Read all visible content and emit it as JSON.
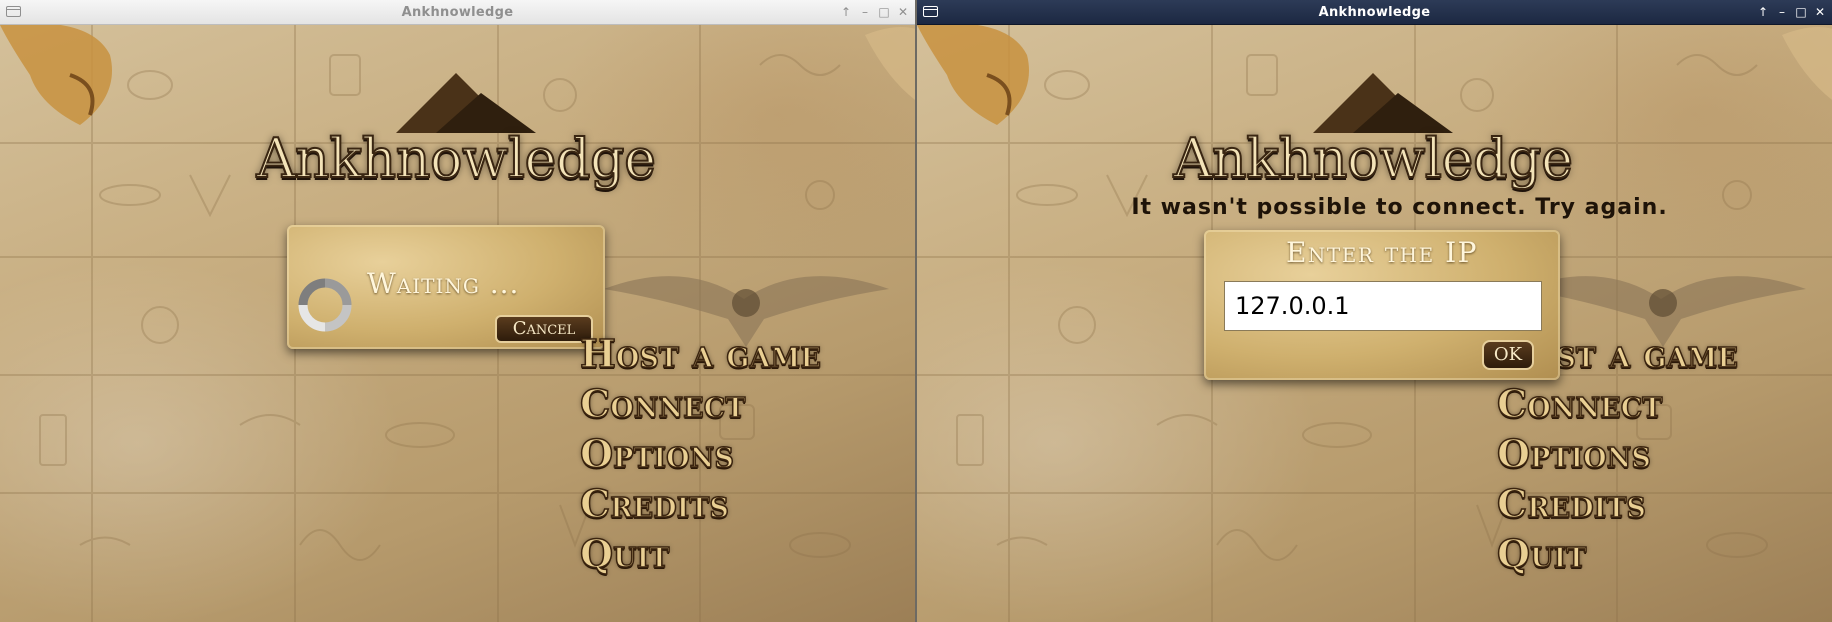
{
  "windows": [
    {
      "title": "Ankhnowledge",
      "state": "inactive",
      "controls": [
        "up-arrow-icon",
        "minimize-icon",
        "maximize-icon",
        "close-icon"
      ],
      "logo": "Ankhnowledge",
      "menu": [
        "Host a game",
        "Connect",
        "Options",
        "Credits",
        "Quit"
      ],
      "dialog": {
        "label": "Waiting ...",
        "cancel_label": "Cancel",
        "spinner_icon": "loading-spinner-icon"
      }
    },
    {
      "title": "Ankhnowledge",
      "state": "active",
      "controls": [
        "up-arrow-icon",
        "minimize-icon",
        "maximize-icon",
        "close-icon"
      ],
      "logo": "Ankhnowledge",
      "menu": [
        "Host a game",
        "Connect",
        "Options",
        "Credits",
        "Quit"
      ],
      "error_message": "It wasn't possible to connect. Try again.",
      "dialog": {
        "title": "Enter the IP",
        "ip_value": "127.0.0.1",
        "ok_label": "OK"
      }
    }
  ],
  "colors": {
    "active_titlebar": "#1c2842",
    "inactive_titlebar": "#e4e4e4",
    "menu_text": "#e9cf93",
    "panel": "#cfb06e",
    "button": "#2e1c0b"
  }
}
